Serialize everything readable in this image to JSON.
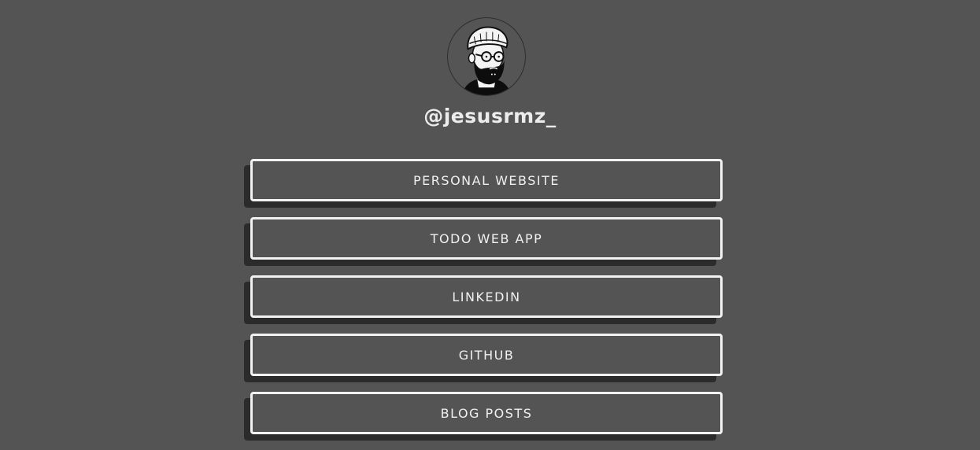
{
  "profile": {
    "username": "@jesusrmz_",
    "avatar_icon": "bearded-man-avatar-icon"
  },
  "links": [
    {
      "label": "PERSONAL WEBSITE"
    },
    {
      "label": "TODO WEB APP"
    },
    {
      "label": "LINKEDIN"
    },
    {
      "label": "GITHUB"
    },
    {
      "label": "BLOG POSTS"
    }
  ],
  "colors": {
    "background": "#545454",
    "button_border": "#f2f2f2",
    "button_shadow": "#2b2b2b",
    "text": "#f0f0f0"
  }
}
